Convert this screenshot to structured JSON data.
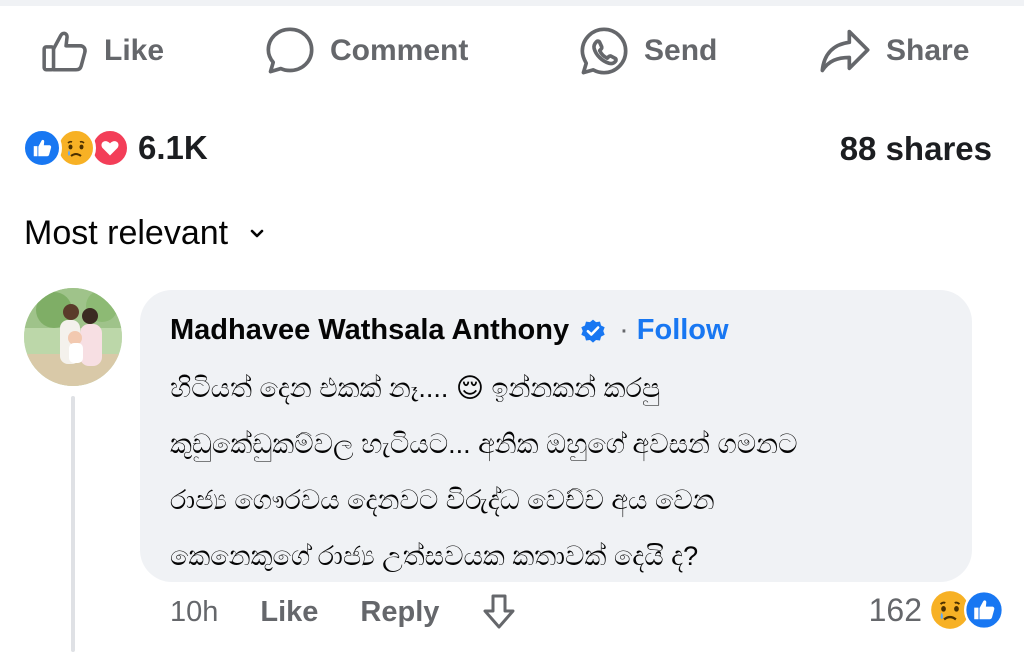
{
  "action_bar": {
    "like_label": "Like",
    "comment_label": "Comment",
    "send_label": "Send",
    "share_label": "Share"
  },
  "post_stats": {
    "reaction_icons": [
      "like-icon",
      "sad-icon",
      "love-icon"
    ],
    "reaction_count": "6.1K",
    "shares_label": "88 shares"
  },
  "comments_sort": {
    "label": "Most relevant",
    "icon": "chevron-down-icon"
  },
  "comment": {
    "author": "Madhavee Wathsala Anthony",
    "verified": true,
    "separator": "·",
    "follow_label": "Follow",
    "lines": [
      "හිටියත් දෙන එකක් නෑ.... 😌 ඉන්නකන් කරපු",
      "කුඩුකේඩුකම්වල හැටියට... අනික ඔහුගේ අවසන් ගමනට",
      "රාජ්‍ය ගෞරවය දෙනවට විරුද්ධ වෙච්ච අය වෙන",
      "කෙනෙකුගේ රාජ්‍ය උත්සවයක කතාවක් දෙයි ද?"
    ],
    "time": "10h",
    "like_label": "Like",
    "reply_label": "Reply",
    "reaction_count": "162",
    "reaction_icons": [
      "sad-icon",
      "like-icon"
    ]
  },
  "colors": {
    "facebook_blue": "#1877f2",
    "muted_text": "#65676b",
    "bubble_bg": "#f0f2f5",
    "love_red": "#f33e58",
    "sad_yellow": "#f7b125"
  }
}
